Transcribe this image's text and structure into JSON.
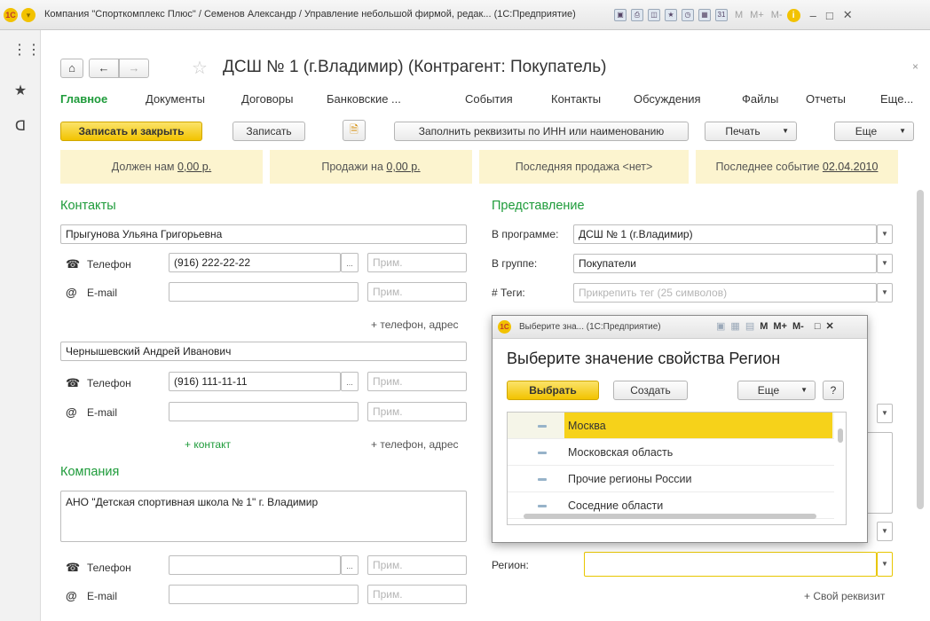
{
  "window": {
    "title": "Компания \"Спорткомплекс Плюс\" / Семенов Александр / Управление небольшой фирмой, редак... (1С:Предприятие)",
    "logo_text": "1С",
    "m_labels": [
      "M",
      "M+",
      "M-"
    ],
    "info_icon": "i",
    "controls": [
      "–",
      "□",
      "✕"
    ]
  },
  "left_panel": {
    "icons": [
      "apps-grid-icon",
      "favorites-star-icon",
      "history-icon"
    ]
  },
  "form": {
    "title": "ДСШ № 1 (г.Владимир) (Контрагент: Покупатель)",
    "close": "×",
    "tabs": [
      "Главное",
      "Документы",
      "Договоры",
      "Банковские ...",
      "События",
      "Контакты",
      "Обсуждения",
      "Файлы",
      "Отчеты",
      "Еще..."
    ],
    "toolbar": {
      "save_close": "Записать и закрыть",
      "save": "Записать",
      "fill_by_inn": "Заполнить реквизиты по ИНН или наименованию",
      "print": "Печать",
      "more": "Еще"
    },
    "info_bar": {
      "owes_label": "Должен нам ",
      "owes_value": "0,00 р.",
      "sales_label": "Продажи на ",
      "sales_value": "0,00 р.",
      "last_sale": "Последняя продажа <нет>",
      "last_event_label": "Последнее событие ",
      "last_event_value": "02.04.2010"
    },
    "contacts": {
      "header": "Контакты",
      "contact1": {
        "name": "Прыгунова Ульяна Григорьевна",
        "phone_label": "Телефон",
        "phone_value": "(916) 222-22-22",
        "phone_note_ph": "Прим.",
        "email_label": "E-mail",
        "email_value": "",
        "email_note_ph": "Прим.",
        "add_phone": "+ телефон, адрес"
      },
      "contact2": {
        "name": "Чернышевский Андрей Иванович",
        "phone_label": "Телефон",
        "phone_value": "(916) 111-11-11",
        "phone_note_ph": "Прим.",
        "email_label": "E-mail",
        "email_value": "",
        "email_note_ph": "Прим.",
        "add_contact": "+ контакт",
        "add_phone": "+ телефон, адрес"
      }
    },
    "company": {
      "header": "Компания",
      "name": "АНО \"Детская спортивная школа  № 1\" г. Владимир",
      "phone_label": "Телефон",
      "phone_note_ph": "Прим.",
      "email_label": "E-mail",
      "email_note_ph": "Прим."
    },
    "presentation": {
      "header": "Представление",
      "program_label": "В программе:",
      "program_value": "ДСШ № 1 (г.Владимир)",
      "group_label": "В группе:",
      "group_value": "Покупатели",
      "tags_label": "# Теги:",
      "tags_ph": "Прикрепить тег (25 символов)",
      "region_label": "Регион:",
      "region_value": "",
      "own_attr": "+ Свой реквизит"
    }
  },
  "dialog": {
    "titlebar": "Выберите зна... (1С:Предприятие)",
    "title": "Выберите значение свойства Регион",
    "select_btn": "Выбрать",
    "create_btn": "Создать",
    "more_btn": "Еще",
    "help_btn": "?",
    "items": [
      "Москва",
      "Московская область",
      "Прочие регионы России",
      "Соседние области"
    ],
    "selected_index": 0
  }
}
